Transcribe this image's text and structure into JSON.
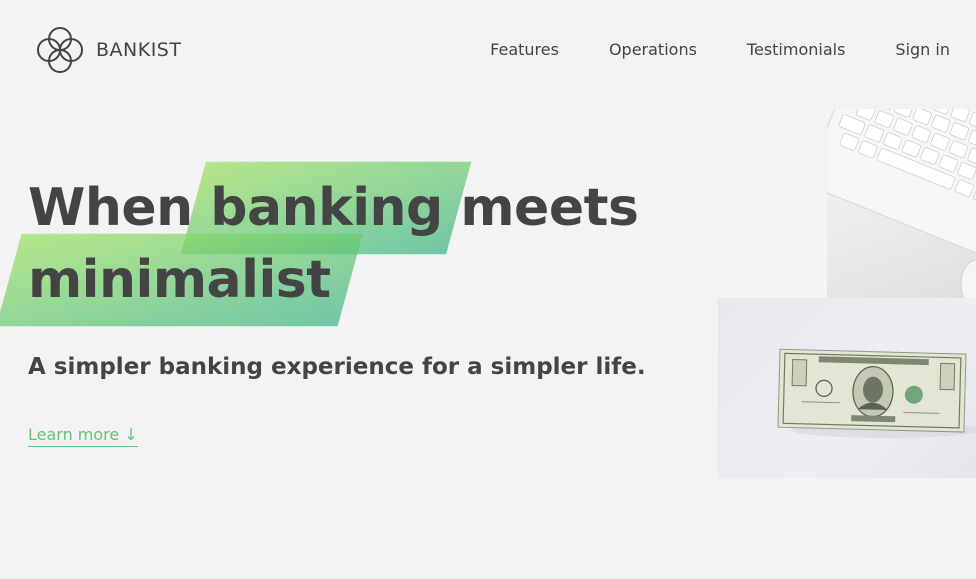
{
  "brand": {
    "name": "BANKIST"
  },
  "nav": {
    "links": [
      {
        "label": "Features"
      },
      {
        "label": "Operations"
      },
      {
        "label": "Testimonials"
      },
      {
        "label": "Sign in"
      }
    ]
  },
  "hero": {
    "title_part1": "When",
    "title_highlight1": "banking",
    "title_part2": "meets",
    "title_highlight2": "minimalist",
    "subtitle": "A simpler banking experience for a simpler life.",
    "learn_more": "Learn more ↓"
  },
  "images": {
    "keyboard": "keyboard-photo",
    "money": "dollar-bill-photo"
  },
  "colors": {
    "background": "#f3f3f3",
    "text": "#444444",
    "accent": "#5ec576",
    "highlight_start": "#9be15d",
    "highlight_end": "#39b385"
  }
}
